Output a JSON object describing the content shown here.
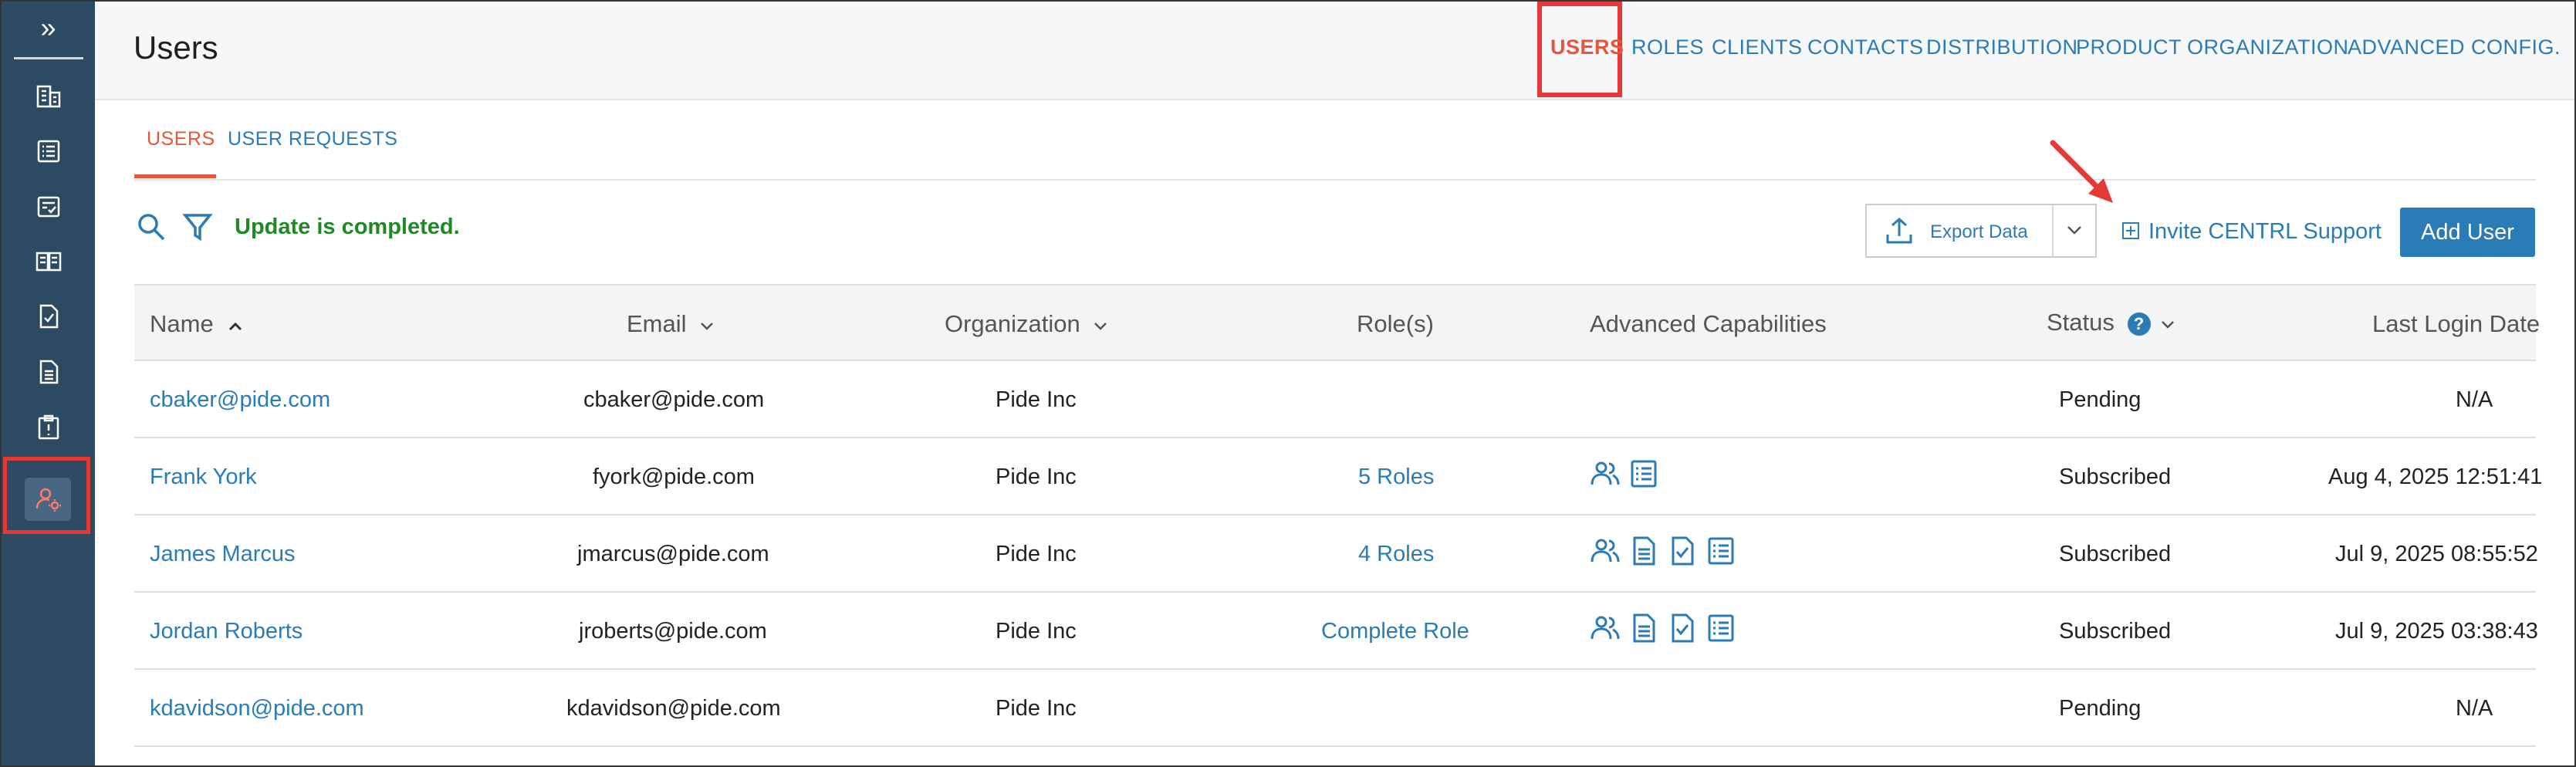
{
  "page": {
    "title": "Users"
  },
  "top_nav": [
    "USERS",
    "ROLES",
    "CLIENTS",
    "CONTACTS",
    "DISTRIBUTION",
    "PRODUCT",
    "ORGANIZATION",
    "ADVANCED CONFIG."
  ],
  "sidebar": {
    "toggle": "»",
    "items": [
      {
        "icon": "building-icon"
      },
      {
        "icon": "list-icon"
      },
      {
        "icon": "checklist-icon"
      },
      {
        "icon": "book-icon"
      },
      {
        "icon": "document-check-icon"
      },
      {
        "icon": "document-icon"
      },
      {
        "icon": "clipboard-alert-icon"
      },
      {
        "icon": "user-settings-icon",
        "active": true
      }
    ]
  },
  "sub_tabs": [
    "USERS",
    "USER REQUESTS"
  ],
  "toolbar": {
    "status_message": "Update is completed.",
    "export_label": "Export Data",
    "invite_label": "Invite CENTRL Support",
    "add_user_label": "Add User"
  },
  "table": {
    "headers": {
      "name": "Name",
      "email": "Email",
      "organization": "Organization",
      "roles": "Role(s)",
      "capabilities": "Advanced Capabilities",
      "status": "Status",
      "last_login": "Last Login Date"
    },
    "rows": [
      {
        "name": "cbaker@pide.com",
        "email": "cbaker@pide.com",
        "organization": "Pide Inc",
        "roles": "",
        "capabilities": [],
        "status": "Pending",
        "last_login": "N/A"
      },
      {
        "name": "Frank York",
        "email": "fyork@pide.com",
        "organization": "Pide Inc",
        "roles": "5 Roles",
        "capabilities": [
          "users-icon",
          "list-icon"
        ],
        "status": "Subscribed",
        "last_login": "Aug 4, 2025 12:51:41"
      },
      {
        "name": "James Marcus",
        "email": "jmarcus@pide.com",
        "organization": "Pide Inc",
        "roles": "4 Roles",
        "capabilities": [
          "users-icon",
          "document-icon",
          "document-check-icon",
          "list-icon"
        ],
        "status": "Subscribed",
        "last_login": "Jul 9, 2025 08:55:52"
      },
      {
        "name": "Jordan Roberts",
        "email": "jroberts@pide.com",
        "organization": "Pide Inc",
        "roles": "Complete Role",
        "capabilities": [
          "users-icon",
          "document-icon",
          "document-check-icon",
          "list-icon"
        ],
        "status": "Subscribed",
        "last_login": "Jul 9, 2025 03:38:43"
      },
      {
        "name": "kdavidson@pide.com",
        "email": "kdavidson@pide.com",
        "organization": "Pide Inc",
        "roles": "",
        "capabilities": [],
        "status": "Pending",
        "last_login": "N/A"
      }
    ]
  },
  "colors": {
    "sidebar": "#2d4a63",
    "link": "#2b7bb5",
    "accent": "#e8553d",
    "success": "#1e8a26",
    "highlight": "#e53935"
  }
}
